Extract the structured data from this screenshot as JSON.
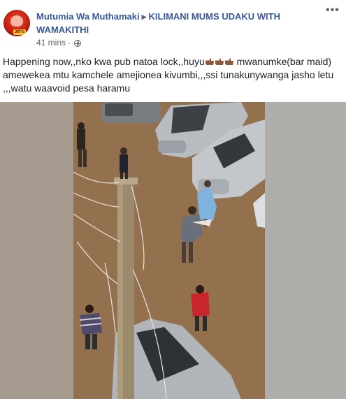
{
  "post": {
    "author": "Mutumia Wa Muthamaki",
    "group": "KILIMANI MUMS UDAKU WITH WAMAKITHI",
    "timestamp": "41 mins",
    "separator": "·",
    "privacy_icon": "globe-icon",
    "more_icon": "more-options-icon",
    "more_label": "•••",
    "avatar_badge": "30%",
    "text_part1": "Happening now,,nko kwa pub natoa lock,,huyu",
    "text_part2": " mwanumke(bar maid) amewekea mtu kamchele amejionea kivumbi,,,ssi tunakunywanga jasho letu ,,,watu waavoid pesa haramu",
    "emoji_name": "pointing-hand-emoji",
    "emoji_count": 3
  },
  "colors": {
    "link": "#385898",
    "text": "#1c1e21",
    "meta": "#616770"
  }
}
